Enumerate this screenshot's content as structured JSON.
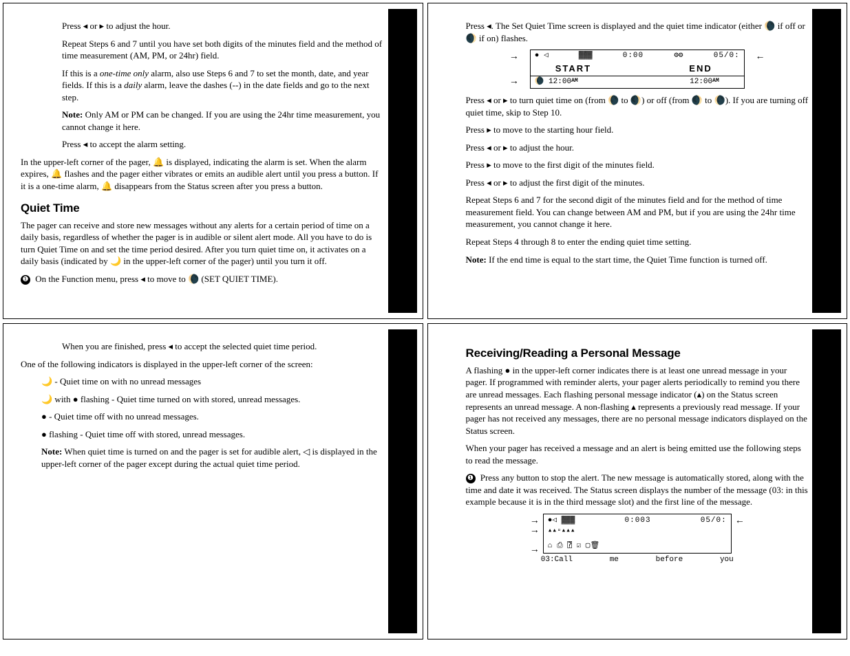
{
  "p1": {
    "s1": "Press ◂ or ▸ to adjust the hour.",
    "s2": "Repeat Steps 6 and 7 until you have set both digits of the minutes field and the method of time measurement (AM, PM, or 24hr) field.",
    "s3a": "If this is a ",
    "s3b": "one-time only",
    "s3c": " alarm, also use Steps 6 and 7 to set the month, date, and year fields. If this is a ",
    "s3d": "daily",
    "s3e": " alarm, leave the dashes (--) in the date fields and go to the next step.",
    "s4a": "Note:",
    "s4b": "  Only AM or PM can be changed. If you are using the 24hr time measurement, you cannot change it here.",
    "s5": "Press ◂ to accept the alarm setting.",
    "s6": "In the upper-left corner of the pager, 🔔 is displayed, indicating the alarm is set. When the alarm expires, 🔔 flashes and the pager either vibrates or emits an audible alert until you press a button. If it is a one-time alarm, 🔔 disappears from the Status screen after you press a button.",
    "h1": "Quiet Time",
    "q1": "The pager can receive and store new messages without any alerts for a certain period of time on a daily basis, regardless of whether the pager is in audible or silent alert mode. All you have to do is turn Quiet Time on and set the time period desired. After you turn quiet time on, it activates on a daily basis (indicated by 🌙 in the upper-left corner of the pager) until you turn it off.",
    "q2": "On the Function menu, press ◂ to move to 🌘 (SET QUIET TIME)."
  },
  "p2": {
    "s1": "Press ◂. The Set Quiet Time screen is displayed and the quiet time indicator (either 🌘 if off or 🌒 if on) flashes.",
    "lcd": {
      "top_l": "● ◁",
      "top_m1": "▓▓▓",
      "top_m2": "0:00",
      "top_m3": "⚙⚙",
      "top_r": "05/0:",
      "mid_l": "START",
      "mid_r": "END",
      "bot_l": "🌘 12:00",
      "bot_l_ampm": "AM",
      "bot_r": "12:00",
      "bot_r_ampm": "AM"
    },
    "s2": "Press ◂ or ▸ to turn quiet time on (from 🌘 to 🌒) or off (from 🌒 to 🌘). If you are turning off quiet time, skip to Step 10.",
    "s3": "Press ▸ to move to the starting hour field.",
    "s4": "Press ◂ or ▸ to adjust the hour.",
    "s5": "Press ▸ to move to the first digit of the minutes field.",
    "s6": "Press ◂ or ▸ to adjust the first digit of the minutes.",
    "s7": "Repeat Steps 6 and 7 for the second digit of the minutes field and for the method of time measurement field. You can change between AM and PM, but if you are using the 24hr time measurement, you cannot change it here.",
    "s8": "Repeat Steps 4 through 8 to enter the ending quiet time setting.",
    "s9a": "Note:",
    "s9b": " If the end time is equal to the start time, the Quiet Time function is turned off."
  },
  "p3": {
    "s1": "When you are finished, press ◂ to accept the selected quiet time period.",
    "s2": "One of the following indicators is displayed in the upper-left corner of the screen:",
    "b1": "🌙  - Quiet time on with no unread messages",
    "b2": "🌙 with ● flashing - Quiet time turned on with stored, unread messages.",
    "b3": "● - Quiet time off with no unread messages.",
    "b4": "● flashing - Quiet time off with stored, unread messages.",
    "n1a": "Note:",
    "n1b": " When quiet time is turned on and the pager is set for audible alert, ◁ is displayed in the upper-left corner of the pager except during the actual quiet time period."
  },
  "p4": {
    "h1": "Receiving/Reading a Personal Message",
    "s1": "A flashing ● in the upper-left corner indicates there is at least one unread message in your pager. If programmed with reminder alerts, your pager alerts periodically to remind you there are unread messages. Each flashing personal message indicator (▴) on the Status screen represents an unread message. A non-flashing ▴ represents a previously read message. If your pager has not received any messages, there are no personal message indicators displayed on the Status screen.",
    "s2": "When your pager has received a message and an alert is being emitted use the following steps to read the message.",
    "s3": "Press any button to stop the alert. The new message is automatically stored, along with the time and date it was received. The Status screen displays the number of the message (03: in this example because it is in the third message slot) and the first line of the message.",
    "lcd": {
      "row1_l": "●◁ ▓▓▓",
      "row1_m": "0:003",
      "row1_r": "05/0:",
      "row2": "▴▴▫▴▴▴",
      "row3_icons": "⌂   ⎙   ⍰   ☑        ▢🗑",
      "msg_a": "03:Call",
      "msg_b": "me",
      "msg_c": "before",
      "msg_d": "you"
    }
  }
}
